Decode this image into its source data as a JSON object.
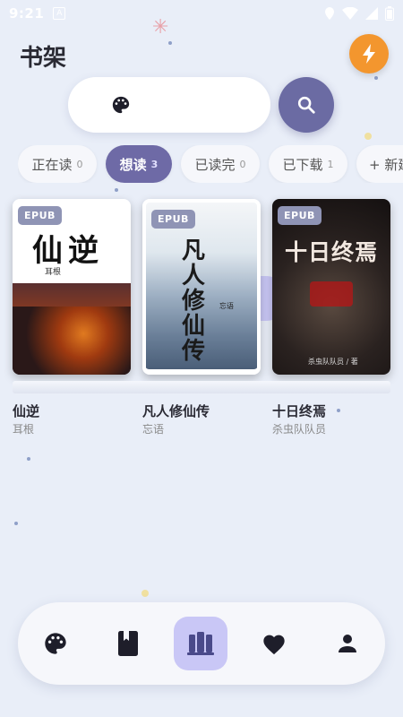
{
  "status_bar": {
    "time": "9:21",
    "notification_icon": "A"
  },
  "header": {
    "title": "书架"
  },
  "mode_toggle": {
    "options": [
      "palette-icon",
      "book-icon"
    ],
    "selected": "book-icon"
  },
  "tabs": [
    {
      "label": "正在读",
      "count": "0"
    },
    {
      "label": "想读",
      "count": "3"
    },
    {
      "label": "已读完",
      "count": "0"
    },
    {
      "label": "已下载",
      "count": "1"
    },
    {
      "label": "+ 新建",
      "count": ""
    }
  ],
  "active_tab": 1,
  "books": [
    {
      "title": "仙逆",
      "author": "耳根",
      "format": "EPUB",
      "cover_text": "仙逆",
      "cover_sub": "耳根"
    },
    {
      "title": "凡人修仙传",
      "author": "忘语",
      "format": "EPUB",
      "cover_text": "凡人修仙传",
      "cover_sub": "忘语"
    },
    {
      "title": "十日终焉",
      "author": "杀虫队队员",
      "format": "EPUB",
      "cover_text": "十日终焉",
      "cover_sub": "杀虫队队员 / 著"
    }
  ],
  "bottom_nav": [
    "palette-icon",
    "bookmark-icon",
    "bookshelf-icon",
    "heart-icon",
    "person-icon"
  ],
  "bottom_nav_active": 2,
  "colors": {
    "accent": "#6e6aa6",
    "accent_light": "#c9c7f6",
    "flash": "#f3962e",
    "background": "#e9eef8"
  }
}
